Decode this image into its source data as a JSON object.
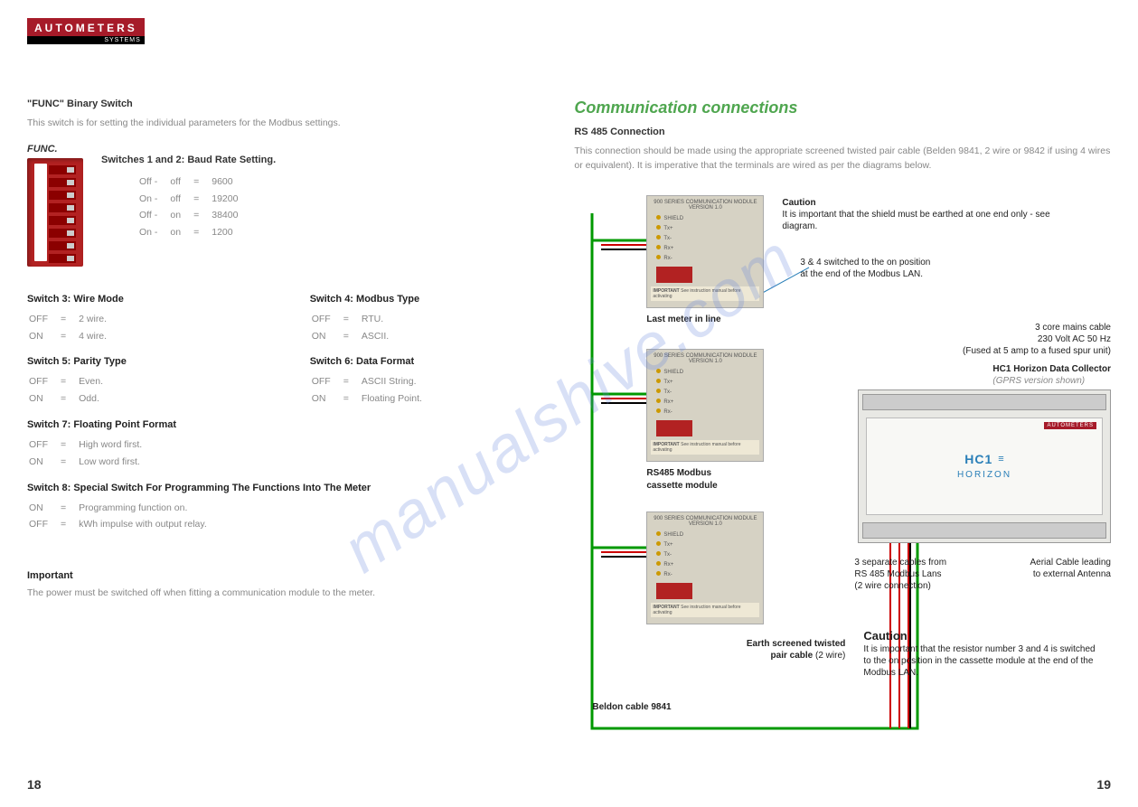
{
  "logo": {
    "brand": "AUTOMETERS",
    "sub": "SYSTEMS"
  },
  "watermark": "manualshive.com",
  "left": {
    "func_title": "\"FUNC\" Binary Switch",
    "func_desc": "This switch is for setting the individual parameters for the Modbus settings.",
    "func_label": "FUNC.",
    "baud_title": "Switches 1 and 2: Baud Rate Setting.",
    "baud_rows": [
      [
        "Off -",
        "off",
        "=",
        "9600"
      ],
      [
        "On -",
        "off",
        "=",
        "19200"
      ],
      [
        "Off -",
        "on",
        "=",
        "38400"
      ],
      [
        "On -",
        "on",
        "=",
        "1200"
      ]
    ],
    "sw3": {
      "title": "Switch 3: Wire Mode",
      "rows": [
        [
          "OFF",
          "=",
          "2 wire."
        ],
        [
          "ON",
          "=",
          "4 wire."
        ]
      ]
    },
    "sw4": {
      "title": "Switch 4: Modbus Type",
      "rows": [
        [
          "OFF",
          "=",
          "RTU."
        ],
        [
          "ON",
          "=",
          "ASCII."
        ]
      ]
    },
    "sw5": {
      "title": "Switch 5: Parity Type",
      "rows": [
        [
          "OFF",
          "=",
          "Even."
        ],
        [
          "ON",
          "=",
          "Odd."
        ]
      ]
    },
    "sw6": {
      "title": "Switch 6: Data Format",
      "rows": [
        [
          "OFF",
          "=",
          "ASCII String."
        ],
        [
          "ON",
          "=",
          "Floating Point."
        ]
      ]
    },
    "sw7": {
      "title": "Switch 7: Floating Point Format",
      "rows": [
        [
          "OFF",
          "=",
          "High word first."
        ],
        [
          "ON",
          "=",
          "Low word first."
        ]
      ]
    },
    "sw8": {
      "title": "Switch 8: Special Switch  For Programming The Functions Into The Meter",
      "rows": [
        [
          "ON",
          "=",
          "Programming function on."
        ],
        [
          "OFF",
          "=",
          "kWh impulse with output relay."
        ]
      ]
    },
    "important_title": "Important",
    "important_text": "The power must be switched off when fitting a communication module to the meter.",
    "pagenum": "18"
  },
  "right": {
    "heading": "Communication connections",
    "sub": "RS 485 Connection",
    "intro": "This connection should be made using the appropriate screened twisted pair cable (Belden 9841, 2 wire or 9842 if using 4 wires or equivalent). It is imperative that the terminals are wired as per the diagrams below.",
    "module_header": "900 SERIES COMMUNICATION MODULE VERSION 1.0",
    "module_imp_label": "IMPORTANT",
    "module_imp_text": "See instruction manual before activating",
    "caution1_title": "Caution",
    "caution1_text": "It is important that the shield must be earthed at one end only - see diagram.",
    "annot1": "3 & 4 switched to the on position at the end of the Modbus LAN.",
    "label1": "Last meter in line",
    "label2a": "RS485 Modbus",
    "label2b": "cassette module",
    "mains1": "3 core mains cable",
    "mains2": "230 Volt AC 50 Hz",
    "mains3": "(Fused at 5 amp to a fused spur unit)",
    "hc1_title": "HC1 Horizon Data Collector",
    "hc1_sub": "(GPRS version shown)",
    "hc1_logo1": "HC1",
    "hc1_logo2": "HORIZON",
    "hc1_aut": "AUTOMETERS",
    "cable_note1a": "3 separate cables from",
    "cable_note1b": "RS 485 Modbus Lans",
    "cable_note1c": "(2 wire connection)",
    "cable_note2a": "Aerial Cable leading",
    "cable_note2b": "to external Antenna",
    "earth1": "Earth screened twisted",
    "earth2": "pair cable (2 wire)",
    "beldon": "Beldon cable 9841",
    "caution2_title": "Caution",
    "caution2_text": "It is important that the resistor number 3 and 4 is switched to the on position in the cassette module at the end of the Modbus LAN.",
    "pagenum": "19"
  }
}
